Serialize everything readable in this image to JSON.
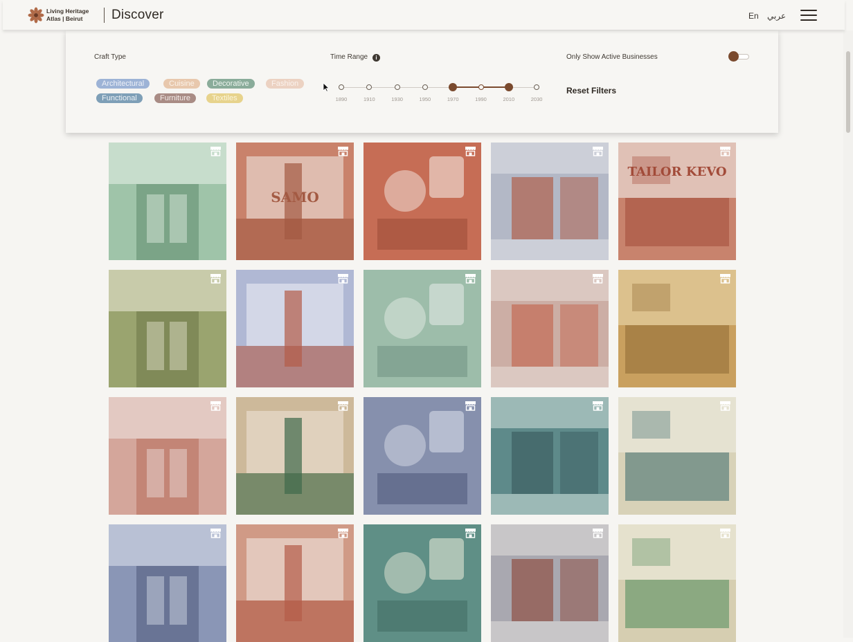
{
  "header": {
    "brand_line1": "Living Heritage",
    "brand_line2": "Atlas | Beirut",
    "title": "Discover",
    "lang_en": "En",
    "lang_ar": "عربي",
    "menu_icon": "hamburger-menu-icon",
    "logo_icon": "atlas-logo-icon"
  },
  "filters": {
    "craft_type_label": "Craft Type",
    "craft_types": [
      {
        "label": "Architectural",
        "color": "#9db3d6",
        "text_color": "#eef1f8"
      },
      {
        "label": "Cuisine",
        "color": "#e8c8ad",
        "text_color": "#fbf3ea"
      },
      {
        "label": "Decorative",
        "color": "#8aac9a",
        "text_color": "#eef5f0"
      },
      {
        "label": "Fashion",
        "color": "#ecd2c2",
        "text_color": "#fbf3ee"
      },
      {
        "label": "Functional",
        "color": "#7e9fb7",
        "text_color": "#eef3f7"
      },
      {
        "label": "Furniture",
        "color": "#a98c85",
        "text_color": "#f6eeeb"
      },
      {
        "label": "Textiles",
        "color": "#e7d38c",
        "text_color": "#fbf5de"
      }
    ],
    "time_range_label": "Time Range",
    "info_icon": "info-icon",
    "years": [
      "1890",
      "1910",
      "1930",
      "1950",
      "1970",
      "1990",
      "2010",
      "2030"
    ],
    "selected_range": [
      "1970",
      "2010"
    ],
    "active_only_label": "Only Show Active Businesses",
    "active_only_on": true,
    "reset_label": "Reset Filters",
    "accent_color": "#7a4a2e"
  },
  "tile_icon": "storefront-icon",
  "tiles": [
    {
      "name": "tile-1",
      "tint": "#9fc4a9",
      "light": "#d9e8dc",
      "dark": "#5d8a6b",
      "text": ""
    },
    {
      "name": "tile-2",
      "tint": "#c9826b",
      "light": "#e6cfc6",
      "dark": "#a35a43",
      "text": "SAMO"
    },
    {
      "name": "tile-3",
      "tint": "#c66d55",
      "light": "#ecd6cc",
      "dark": "#9b4b37",
      "text": ""
    },
    {
      "name": "tile-4",
      "tint": "#b3b8c6",
      "light": "#dcdde4",
      "dark": "#b05a44",
      "text": ""
    },
    {
      "name": "tile-5",
      "tint": "#c8836d",
      "light": "#ece2dd",
      "dark": "#a24b39",
      "text": "TAILOR KEVO"
    },
    {
      "name": "tile-6",
      "tint": "#9aa46f",
      "light": "#dcdcc3",
      "dark": "#6b7446",
      "text": ""
    },
    {
      "name": "tile-7",
      "tint": "#b0b8d4",
      "light": "#dfe2ee",
      "dark": "#b45c48",
      "text": ""
    },
    {
      "name": "tile-8",
      "tint": "#9dbdaa",
      "light": "#d7e3db",
      "dark": "#6f9282",
      "text": ""
    },
    {
      "name": "tile-9",
      "tint": "#ccaea5",
      "light": "#e4d9d4",
      "dark": "#c3664f",
      "text": ""
    },
    {
      "name": "tile-10",
      "tint": "#c9a05f",
      "light": "#e7d3a6",
      "dark": "#8e6a33",
      "text": ""
    },
    {
      "name": "tile-11",
      "tint": "#d4a69b",
      "light": "#e9d8d3",
      "dark": "#b56a58",
      "text": ""
    },
    {
      "name": "tile-12",
      "tint": "#cdb99a",
      "light": "#e6dac8",
      "dark": "#3f6a4b",
      "text": ""
    },
    {
      "name": "tile-13",
      "tint": "#8690ad",
      "light": "#cbd0de",
      "dark": "#4c5679",
      "text": ""
    },
    {
      "name": "tile-14",
      "tint": "#5e8a8a",
      "light": "#c7d8d4",
      "dark": "#3a5c5f",
      "text": ""
    },
    {
      "name": "tile-15",
      "tint": "#d8d2b8",
      "light": "#ecebde",
      "dark": "#3d6a6c",
      "text": ""
    },
    {
      "name": "tile-16",
      "tint": "#8a96b6",
      "light": "#cdd3e2",
      "dark": "#4e5a7a",
      "text": ""
    },
    {
      "name": "tile-17",
      "tint": "#d09a86",
      "light": "#ead6cc",
      "dark": "#b35c48",
      "text": ""
    },
    {
      "name": "tile-18",
      "tint": "#5f8f86",
      "light": "#cfd8c9",
      "dark": "#3f6b62",
      "text": ""
    },
    {
      "name": "tile-19",
      "tint": "#a9a8b0",
      "light": "#dedad8",
      "dark": "#8d4a3d",
      "text": ""
    },
    {
      "name": "tile-20",
      "tint": "#d6ceb1",
      "light": "#ecebdc",
      "dark": "#4f8a5a",
      "text": ""
    }
  ]
}
